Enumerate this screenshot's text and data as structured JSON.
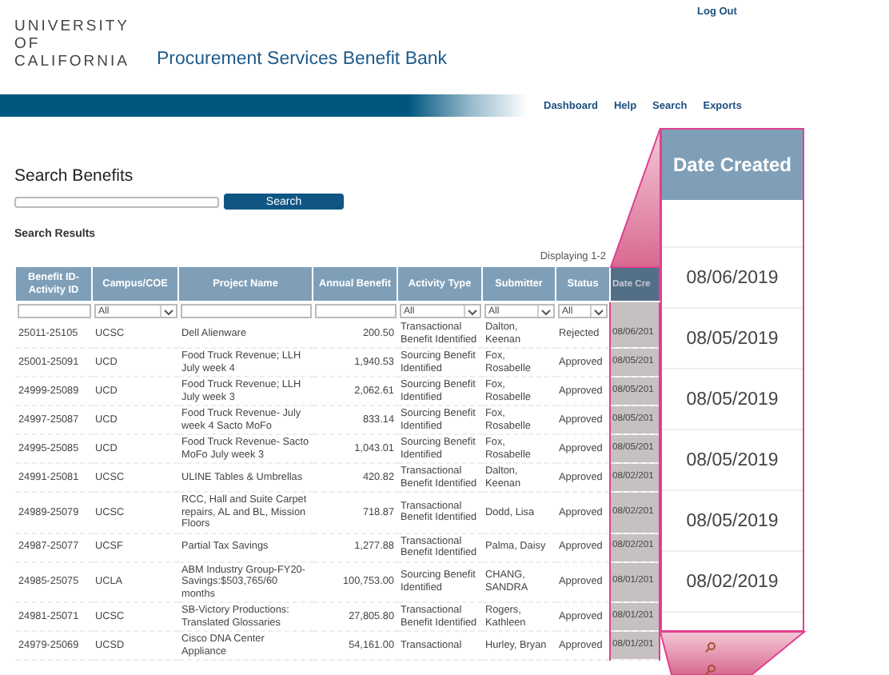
{
  "header": {
    "logo_lines": [
      "UNIVERSITY",
      "OF",
      "CALIFORNIA"
    ],
    "app_title": "Procurement Services Benefit Bank",
    "logout": "Log Out",
    "nav": [
      "Dashboard",
      "Help",
      "Search",
      "Exports"
    ]
  },
  "search": {
    "heading": "Search Benefits",
    "button": "Search"
  },
  "results": {
    "heading": "Search Results",
    "displaying": "Displaying 1-2",
    "columns": [
      "Benefit ID-Activity ID",
      "Campus/COE",
      "Project Name",
      "Annual Benefit",
      "Activity Type",
      "Submitter",
      "Status",
      "Date Cre"
    ],
    "filters": [
      {
        "kind": "text"
      },
      {
        "kind": "select",
        "value": "All"
      },
      {
        "kind": "text"
      },
      {
        "kind": "text"
      },
      {
        "kind": "select",
        "value": "All"
      },
      {
        "kind": "select",
        "value": "All"
      },
      {
        "kind": "select",
        "value": "All"
      },
      {
        "kind": "none"
      }
    ],
    "rows": [
      [
        "25011-25105",
        "UCSC",
        "Dell Alienware",
        "200.50",
        "Transactional Benefit Identified",
        "Dalton, Keenan",
        "Rejected",
        "08/06/201"
      ],
      [
        "25001-25091",
        "UCD",
        "Food Truck Revenue; LLH July week 4",
        "1,940.53",
        "Sourcing Benefit Identified",
        "Fox, Rosabelle",
        "Approved",
        "08/05/201"
      ],
      [
        "24999-25089",
        "UCD",
        "Food Truck Revenue; LLH July week 3",
        "2,062.61",
        "Sourcing Benefit Identified",
        "Fox, Rosabelle",
        "Approved",
        "08/05/201"
      ],
      [
        "24997-25087",
        "UCD",
        "Food Truck Revenue- July week 4 Sacto MoFo",
        "833.14",
        "Sourcing Benefit Identified",
        "Fox, Rosabelle",
        "Approved",
        "08/05/201"
      ],
      [
        "24995-25085",
        "UCD",
        "Food Truck Revenue- Sacto MoFo July week 3",
        "1,043.01",
        "Sourcing Benefit Identified",
        "Fox, Rosabelle",
        "Approved",
        "08/05/201"
      ],
      [
        "24991-25081",
        "UCSC",
        "ULINE Tables & Umbrellas",
        "420.82",
        "Transactional Benefit Identified",
        "Dalton, Keenan",
        "Approved",
        "08/02/201"
      ],
      [
        "24989-25079",
        "UCSC",
        "RCC, Hall and Suite Carpet repairs, AL and BL, Mission Floors",
        "718.87",
        "Transactional Benefit Identified",
        "Dodd, Lisa",
        "Approved",
        "08/02/201"
      ],
      [
        "24987-25077",
        "UCSF",
        "Partial Tax Savings",
        "1,277.88",
        "Transactional Benefit Identified",
        "Palma, Daisy",
        "Approved",
        "08/02/201"
      ],
      [
        "24985-25075",
        "UCLA",
        "ABM Industry Group-FY20-Savings:$503,765/60 months",
        "100,753.00",
        "Sourcing Benefit Identified",
        "CHANG, SANDRA",
        "Approved",
        "08/01/201"
      ],
      [
        "24981-25071",
        "UCSC",
        "SB-Victory Productions: Translated Glossaries",
        "27,805.80",
        "Transactional Benefit Identified",
        "Rogers, Kathleen",
        "Approved",
        "08/01/201"
      ],
      [
        "24979-25069",
        "UCSD",
        "Cisco DNA Center Appliance",
        "54,161.00",
        "Transactional",
        "Hurley, Bryan",
        "Approved",
        "08/01/201"
      ]
    ]
  },
  "callout": {
    "header": "Date Created",
    "dates": [
      "08/06/2019",
      "08/05/2019",
      "08/05/2019",
      "08/05/2019",
      "08/05/2019",
      "08/02/2019"
    ]
  }
}
